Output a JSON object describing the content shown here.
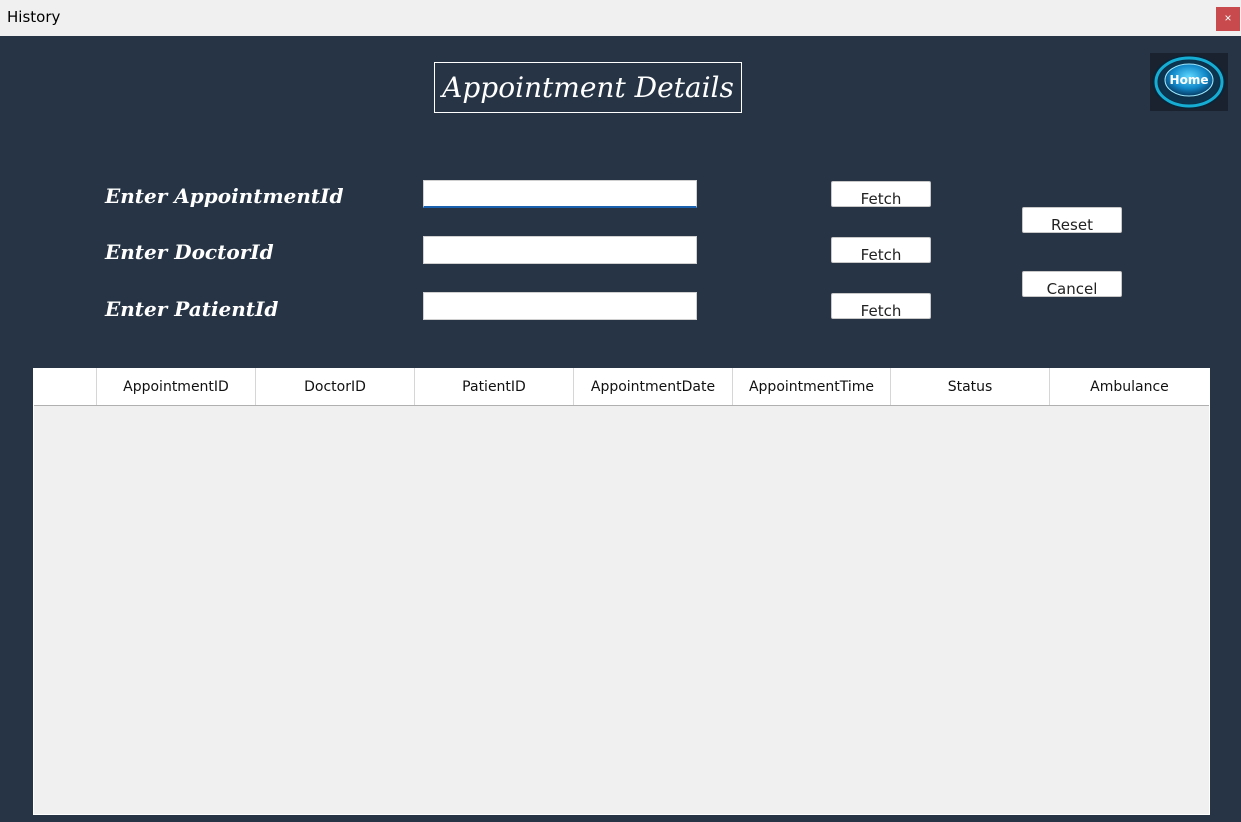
{
  "window": {
    "title": "History",
    "close_glyph": "×"
  },
  "header": {
    "title": "Appointment Details",
    "home_label": "Home"
  },
  "form": {
    "appointment_label": "Enter AppointmentId",
    "doctor_label": "Enter DoctorId",
    "patient_label": "Enter PatientId",
    "appointment_value": "",
    "doctor_value": "",
    "patient_value": "",
    "fetch_label": "Fetch",
    "reset_label": "Reset",
    "cancel_label": "Cancel"
  },
  "table": {
    "columns": [
      "",
      "AppointmentID",
      "DoctorID",
      "PatientID",
      "AppointmentDate",
      "AppointmentTime",
      "Status",
      "Ambulance"
    ],
    "rows": []
  },
  "colors": {
    "background": "#263445",
    "close_button": "#c94a4c",
    "input_focus": "#1a62b0",
    "home_glow": "#19c4ef"
  }
}
